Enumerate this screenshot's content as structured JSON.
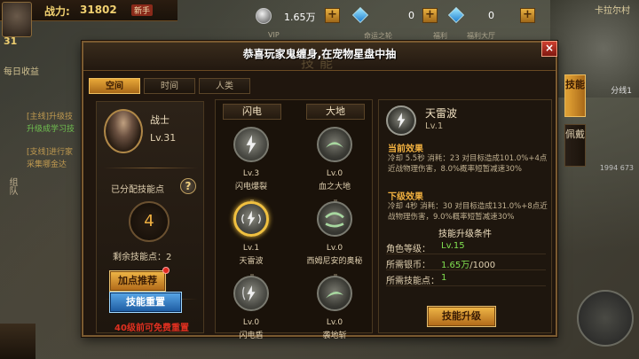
{
  "hud": {
    "power_label": "战力:",
    "power_value": "31802",
    "badge": "新手",
    "player_level": "31",
    "daily_gain": "每日收益",
    "side_label": "组队",
    "quests": [
      {
        "text": "[主线]升级技",
        "color": "gold"
      },
      {
        "text": "升级成学习技",
        "color": "green"
      },
      {
        "text": "[支线]进行家",
        "color": "gold"
      },
      {
        "text": "采集哪金达",
        "color": "gold"
      }
    ]
  },
  "currency": {
    "silver": "1.65万",
    "diamond": "0",
    "bound_diamond": "0",
    "labels": [
      "VIP",
      "命运之轮",
      "福利",
      "福利大厅"
    ]
  },
  "map": {
    "title": "卡拉尔村",
    "line": "分线1",
    "coords": "1994  673"
  },
  "dialog": {
    "title": "技能",
    "announcement": "恭喜玩家鬼缠身,在宠物星盘中抽",
    "close_label": "×",
    "tabs": [
      {
        "label": "空间",
        "active": true
      },
      {
        "label": "时间",
        "active": false
      },
      {
        "label": "人类",
        "active": false
      }
    ]
  },
  "character": {
    "class_name": "战士",
    "level": "Lv.31",
    "assigned_label": "已分配技能点",
    "assigned_points": "4",
    "remaining_label": "剩余技能点：2",
    "recommend_button": "加点推荐",
    "reset_button": "技能重置",
    "free_reset_note": "40级前可免费重置"
  },
  "skill_tree": {
    "columns": [
      "闪电",
      "大地"
    ],
    "skills": [
      {
        "lv": "Lv.3",
        "name": "闪电爆裂",
        "element": "lightning",
        "selected": false
      },
      {
        "lv": "Lv.0",
        "name": "血之大地",
        "element": "earth",
        "selected": false
      },
      {
        "lv": "Lv.1",
        "name": "天雷波",
        "element": "lightning",
        "selected": true
      },
      {
        "lv": "Lv.0",
        "name": "西姆尼安的奥秘",
        "element": "earth",
        "selected": false
      },
      {
        "lv": "Lv.0",
        "name": "闪电盾",
        "element": "lightning",
        "selected": false
      },
      {
        "lv": "Lv.0",
        "name": "袭地斩",
        "element": "earth",
        "selected": false
      }
    ]
  },
  "detail": {
    "name": "天雷波",
    "level": "Lv.1",
    "current_title": "当前效果",
    "current_text": "冷却 5.5秒  消耗：23  对目标造成101.0%+4点近战物理伤害，8.0%概率短暂减速30%",
    "next_title": "下级效果",
    "next_text": "冷却 4秒  消耗：30  对目标造成131.0%+8点近战物理伤害，9.0%概率短暂减速30%",
    "req_title": "技能升级条件",
    "requirements": [
      {
        "label": "角色等级：",
        "value": "Lv.15",
        "suffix": ""
      },
      {
        "label": "所需银币：",
        "value": "1.65万",
        "suffix": "/1000"
      },
      {
        "label": "所需技能点：",
        "value": "1",
        "suffix": ""
      }
    ],
    "upgrade_button": "技能升级"
  },
  "side_tabs": [
    {
      "label": "技能",
      "active": true
    },
    {
      "label": "佩戴",
      "active": false
    }
  ],
  "colors": {
    "accent_orange": "#e8a838",
    "button_blue": "#1c5aa0",
    "value_green": "#80e050",
    "warning_red": "#e03020"
  }
}
